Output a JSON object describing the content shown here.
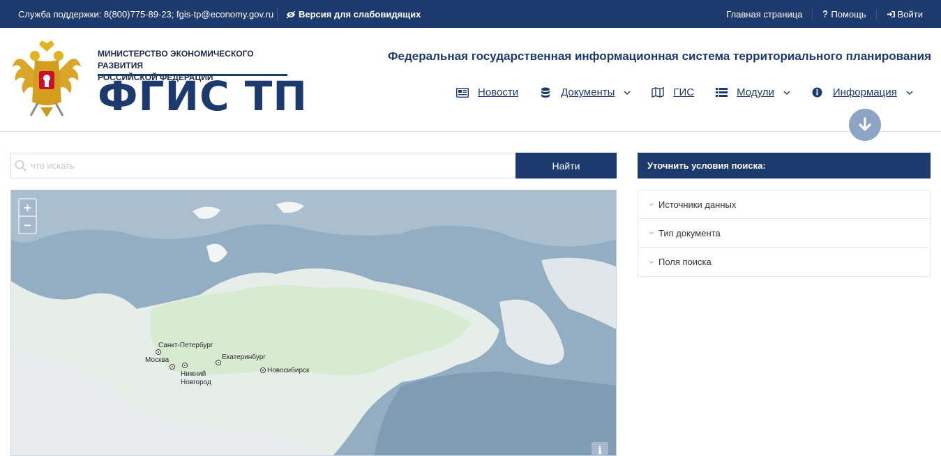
{
  "topbar": {
    "support": "Служба поддержки: 8(800)775-89-23; fgis-tp@economy.gov.ru",
    "impaired_version": "Версия для слабовидящих",
    "home": "Главная страница",
    "help": "Помощь",
    "login": "Войти"
  },
  "header": {
    "ministry_line1": "МИНИСТЕРСТВО ЭКОНОМИЧЕСКОГО РАЗВИТИЯ",
    "ministry_line2": "РОССИЙСКОЙ ФЕДЕРАЦИИ",
    "logo": "ФГИС ТП",
    "system_title": "Федеральная государственная информационная система территориального планирования"
  },
  "nav": [
    {
      "label": "Новости",
      "icon": "newspaper-icon"
    },
    {
      "label": "Документы",
      "icon": "database-icon",
      "dropdown": true
    },
    {
      "label": "ГИС",
      "icon": "map-icon"
    },
    {
      "label": "Модули",
      "icon": "list-icon",
      "dropdown": true
    },
    {
      "label": "Информация",
      "icon": "info-circle-icon",
      "dropdown": true
    }
  ],
  "search": {
    "placeholder": "что искать",
    "button": "Найти"
  },
  "map": {
    "zoom_in": "+",
    "zoom_out": "−",
    "info": "i",
    "cities": [
      "Санкт-Петербург",
      "Москва",
      "Нижний Новгород",
      "Екатеринбург",
      "Новосибирск"
    ]
  },
  "filters": {
    "title": "Уточнить условия поиска:",
    "items": [
      "Источники данных",
      "Тип документа",
      "Поля поиска"
    ]
  },
  "colors": {
    "brand": "#1c3a6e",
    "scroll_button": "#8ea4c4"
  }
}
